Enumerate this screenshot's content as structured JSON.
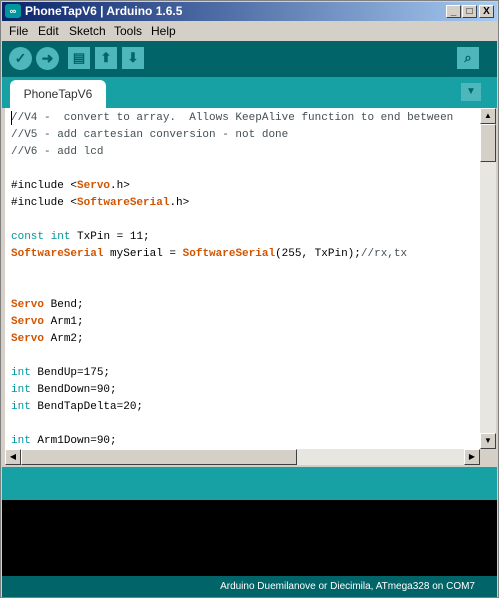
{
  "window": {
    "title": "PhoneTapV6 | Arduino 1.6.5",
    "icon_glyph": "∞",
    "minimize_glyph": "_",
    "maximize_glyph": "□",
    "close_glyph": "X"
  },
  "menu": {
    "items": [
      "File",
      "Edit",
      "Sketch",
      "Tools",
      "Help"
    ]
  },
  "toolbar": {
    "verify_glyph": "✓",
    "upload_glyph": "➜",
    "new_glyph": "▤",
    "open_glyph": "⬆",
    "save_glyph": "⬇",
    "serial_monitor_glyph": "⌕",
    "icons": [
      "verify-icon",
      "upload-icon",
      "new-icon",
      "open-icon",
      "save-icon",
      "serial-monitor-icon"
    ]
  },
  "tabs": {
    "items": [
      {
        "label": "PhoneTapV6",
        "active": true
      }
    ],
    "menu_glyph": "▼"
  },
  "editor": {
    "lines": [
      [
        {
          "t": "cm",
          "v": "//V4 -  convert to array.  Allows KeepAlive function to end between"
        }
      ],
      [
        {
          "t": "cm",
          "v": "//V5 - add cartesian conversion - not done"
        }
      ],
      [
        {
          "t": "cm",
          "v": "//V6 - add lcd"
        }
      ],
      [],
      [
        {
          "t": "",
          "v": "#include <"
        },
        {
          "t": "ty",
          "v": "Servo"
        },
        {
          "t": "",
          "v": ".h>"
        }
      ],
      [
        {
          "t": "",
          "v": "#include <"
        },
        {
          "t": "ty",
          "v": "SoftwareSerial"
        },
        {
          "t": "",
          "v": ".h>"
        }
      ],
      [],
      [
        {
          "t": "kw",
          "v": "const"
        },
        {
          "t": "",
          "v": " "
        },
        {
          "t": "kw",
          "v": "int"
        },
        {
          "t": "",
          "v": " TxPin = 11;"
        }
      ],
      [
        {
          "t": "ty",
          "v": "SoftwareSerial"
        },
        {
          "t": "",
          "v": " mySerial = "
        },
        {
          "t": "ty",
          "v": "SoftwareSerial"
        },
        {
          "t": "",
          "v": "(255, TxPin);"
        },
        {
          "t": "cm",
          "v": "//rx,tx"
        }
      ],
      [],
      [],
      [
        {
          "t": "ty",
          "v": "Servo"
        },
        {
          "t": "",
          "v": " Bend;"
        }
      ],
      [
        {
          "t": "ty",
          "v": "Servo"
        },
        {
          "t": "",
          "v": " Arm1;"
        }
      ],
      [
        {
          "t": "ty",
          "v": "Servo"
        },
        {
          "t": "",
          "v": " Arm2;"
        }
      ],
      [],
      [
        {
          "t": "kw",
          "v": "int"
        },
        {
          "t": "",
          "v": " BendUp=175;"
        }
      ],
      [
        {
          "t": "kw",
          "v": "int"
        },
        {
          "t": "",
          "v": " BendDown=90;"
        }
      ],
      [
        {
          "t": "kw",
          "v": "int"
        },
        {
          "t": "",
          "v": " BendTapDelta=20;"
        }
      ],
      [],
      [
        {
          "t": "kw",
          "v": "int"
        },
        {
          "t": "",
          "v": " Arm1Down=90;"
        }
      ]
    ]
  },
  "scrollbars": {
    "up_glyph": "▲",
    "down_glyph": "▼",
    "left_glyph": "◀",
    "right_glyph": "▶"
  },
  "status": {
    "board": "Arduino Duemilanove or Diecimila, ATmega328 on COM7"
  },
  "colors": {
    "teal_dark": "#006468",
    "teal_mid": "#17a1a5",
    "keyword": "#00979c",
    "type": "#d35400"
  }
}
